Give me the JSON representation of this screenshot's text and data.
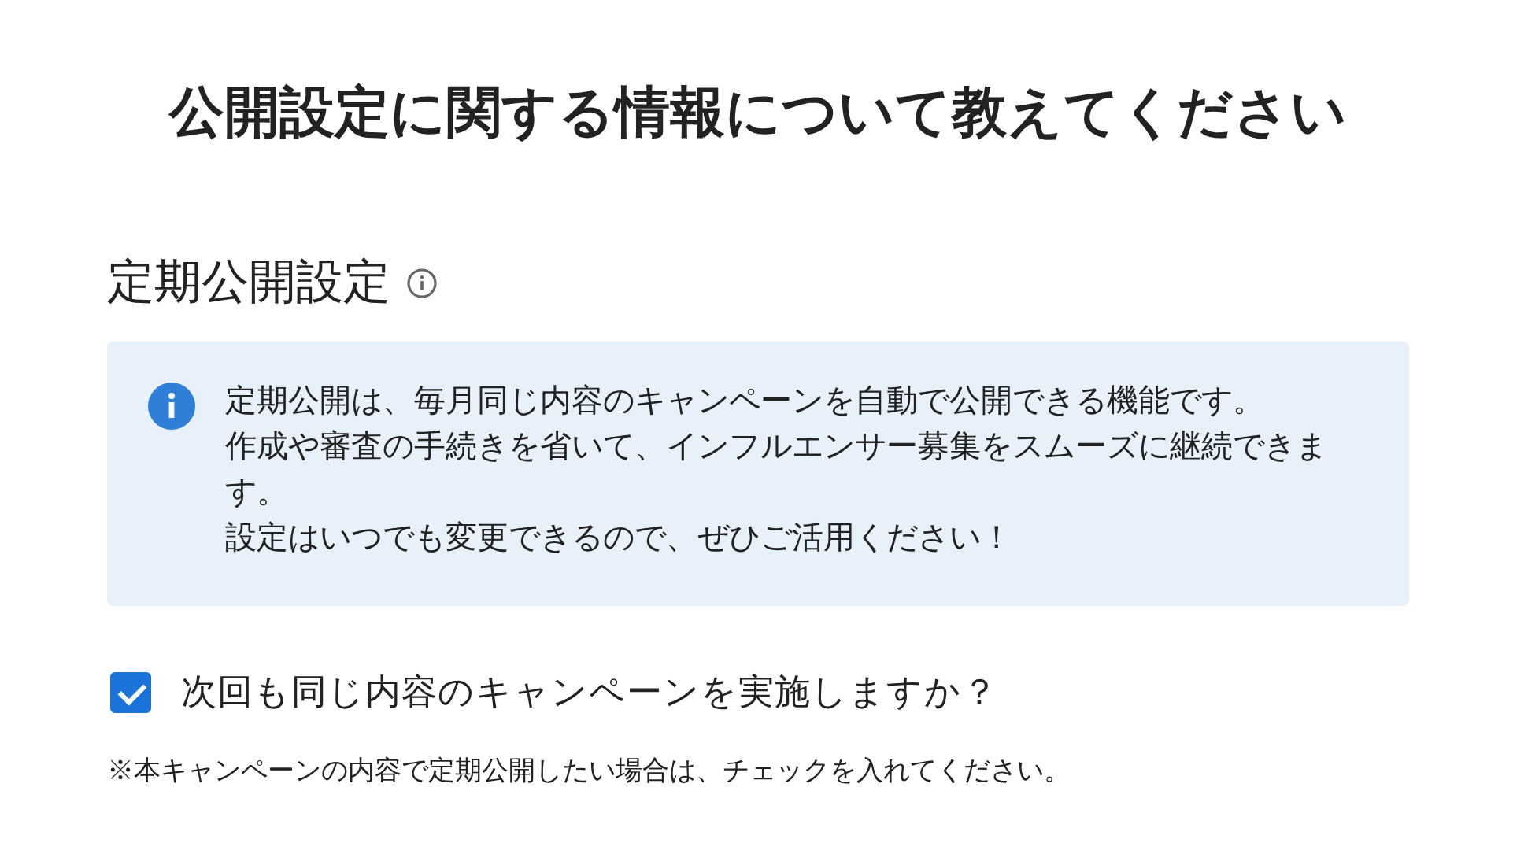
{
  "page_title": "公開設定に関する情報について教えてください",
  "section": {
    "heading": "定期公開設定",
    "info_lines": [
      "定期公開は、毎月同じ内容のキャンペーンを自動で公開できる機能です。",
      "作成や審査の手続きを省いて、インフルエンサー募集をスムーズに継続できます。",
      "設定はいつでも変更できるので、ぜひご活用ください！"
    ]
  },
  "checkbox": {
    "label": "次回も同じ内容のキャンペーンを実施しますか？",
    "checked": true
  },
  "note": "※本キャンペーンの内容で定期公開したい場合は、チェックを入れてください。"
}
